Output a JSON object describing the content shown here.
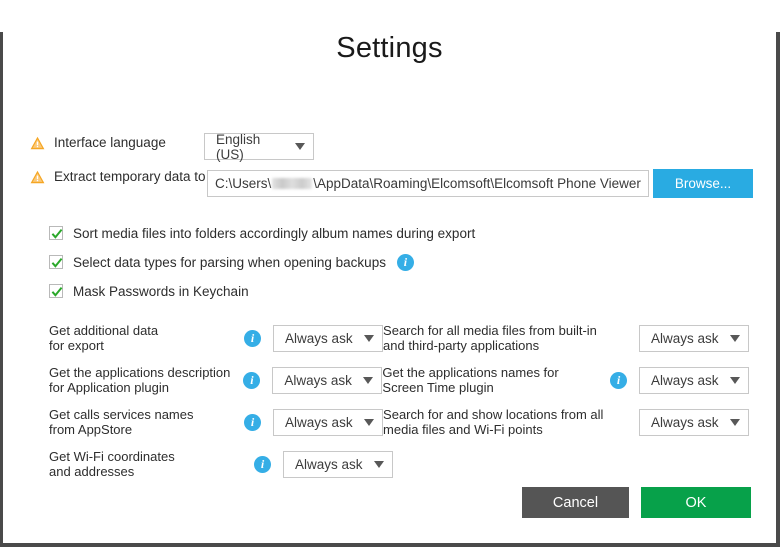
{
  "dialog": {
    "title": "Settings"
  },
  "language_row": {
    "warning_icon": "warning-triangle-icon",
    "label": "Interface language",
    "selected": "English (US)",
    "caret_icon": "chevron-down-icon"
  },
  "path_row": {
    "warning_icon": "warning-triangle-icon",
    "label": "Extract temporary data to",
    "value_prefix": "C:\\Users\\",
    "value_suffix": "\\AppData\\Roaming\\Elcomsoft\\Elcomsoft Phone Viewer",
    "redacted_note": "username-redacted",
    "browse_label": "Browse..."
  },
  "checkboxes": [
    {
      "label": "Sort media files into folders accordingly album names during export",
      "checked": true,
      "has_info": false
    },
    {
      "label": "Select data types for parsing when opening backups",
      "checked": true,
      "has_info": true
    },
    {
      "label": "Mask Passwords in Keychain",
      "checked": true,
      "has_info": false
    }
  ],
  "options": [
    {
      "left": {
        "line1": "Get additional data",
        "line2": "for export",
        "has_info": true,
        "selected": "Always ask"
      },
      "right": {
        "line1": "Search for all media files from built-in",
        "line2": "and third-party applications",
        "has_info": false,
        "selected": "Always ask"
      }
    },
    {
      "left": {
        "line1": "Get the applications description",
        "line2": "for Application plugin",
        "has_info": true,
        "selected": "Always ask"
      },
      "right": {
        "line1": "Get the applications names for",
        "line2": "Screen Time plugin",
        "has_info": true,
        "selected": "Always ask"
      }
    },
    {
      "left": {
        "line1": "Get calls services names",
        "line2": "from AppStore",
        "has_info": true,
        "selected": "Always ask"
      },
      "right": {
        "line1": "Search for and show locations from all",
        "line2": "media files and Wi-Fi points",
        "has_info": false,
        "selected": "Always ask"
      }
    },
    {
      "left": {
        "line1": "Get Wi-Fi coordinates",
        "line2": "and addresses",
        "has_info": true,
        "selected": "Always ask"
      },
      "right": null
    }
  ],
  "footer": {
    "cancel_label": "Cancel",
    "ok_label": "OK"
  },
  "colors": {
    "browse_blue": "#29abe2",
    "ok_green": "#07a14a",
    "cancel_gray": "#555555",
    "info_blue": "#35aee6",
    "warning_orange": "#f5a623",
    "check_green": "#2aa82a",
    "border_dark": "#4a4a4a"
  }
}
